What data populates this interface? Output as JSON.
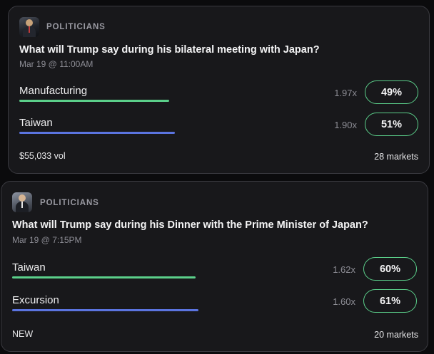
{
  "cards": [
    {
      "category": "POLITICIANS",
      "question": "What will Trump say during his bilateral meeting with Japan?",
      "date": "Mar 19 @ 11:00AM",
      "outcomes": [
        {
          "label": "Manufacturing",
          "multiplier": "1.97x",
          "percent": "49%",
          "probability": 0.49,
          "bar_color": "#5bcf8a"
        },
        {
          "label": "Taiwan",
          "multiplier": "1.90x",
          "percent": "51%",
          "probability": 0.51,
          "bar_color": "#5b74e0"
        }
      ],
      "footer_left": "$55,033 vol",
      "footer_right": "28 markets"
    },
    {
      "category": "POLITICIANS",
      "question": "What will Trump say during his Dinner with the Prime Minister of Japan?",
      "date": "Mar 19 @ 7:15PM",
      "outcomes": [
        {
          "label": "Taiwan",
          "multiplier": "1.62x",
          "percent": "60%",
          "probability": 0.6,
          "bar_color": "#5bcf8a"
        },
        {
          "label": "Excursion",
          "multiplier": "1.60x",
          "percent": "61%",
          "probability": 0.61,
          "bar_color": "#5b74e0"
        }
      ],
      "footer_left": "NEW",
      "footer_right": "20 markets"
    }
  ],
  "colors": {
    "background": "#0b0b0d",
    "card": "#18181b",
    "accent_green": "#5bcf8a",
    "accent_blue": "#5b74e0"
  }
}
